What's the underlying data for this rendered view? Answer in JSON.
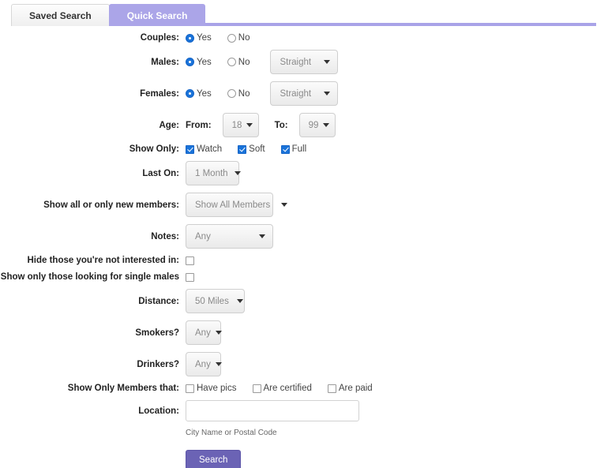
{
  "tabs": [
    {
      "label": "Saved Search",
      "active": false
    },
    {
      "label": "Quick Search",
      "active": true
    }
  ],
  "accent_color": "#a9a3e8",
  "active_tab_color": "#aba5e8",
  "search_button_color": "#6b63b5",
  "checked_control_color": "#1a73d9",
  "form": {
    "couples": {
      "label": "Couples:",
      "yes_label": "Yes",
      "no_label": "No",
      "selected": "Yes"
    },
    "males": {
      "label": "Males:",
      "yes_label": "Yes",
      "no_label": "No",
      "selected": "Yes",
      "orientation_value": "Straight"
    },
    "females": {
      "label": "Females:",
      "yes_label": "Yes",
      "no_label": "No",
      "selected": "Yes",
      "orientation_value": "Straight"
    },
    "age": {
      "label": "Age:",
      "from_label": "From:",
      "from_value": "18",
      "to_label": "To:",
      "to_value": "99"
    },
    "show_only": {
      "label": "Show Only:",
      "options": [
        {
          "label": "Watch",
          "checked": true
        },
        {
          "label": "Soft",
          "checked": true
        },
        {
          "label": "Full",
          "checked": true
        }
      ]
    },
    "last_on": {
      "label": "Last On:",
      "value": "1 Month"
    },
    "members_scope": {
      "label": "Show all or only new members:",
      "value": "Show All Members"
    },
    "notes": {
      "label": "Notes:",
      "value": "Any"
    },
    "hide_not_interested": {
      "label": "Hide those you're not interested in:",
      "checked": false
    },
    "only_single_males": {
      "label": "Show only those looking for single males",
      "checked": false
    },
    "distance": {
      "label": "Distance:",
      "value": "50 Miles"
    },
    "smokers": {
      "label": "Smokers?",
      "value": "Any"
    },
    "drinkers": {
      "label": "Drinkers?",
      "value": "Any"
    },
    "members_that": {
      "label": "Show Only Members that:",
      "options": [
        {
          "label": "Have pics",
          "checked": false
        },
        {
          "label": "Are certified",
          "checked": false
        },
        {
          "label": "Are paid",
          "checked": false
        }
      ]
    },
    "location": {
      "label": "Location:",
      "value": "",
      "placeholder": "",
      "hint": "City Name or Postal Code"
    },
    "submit": {
      "label": "Search"
    }
  }
}
